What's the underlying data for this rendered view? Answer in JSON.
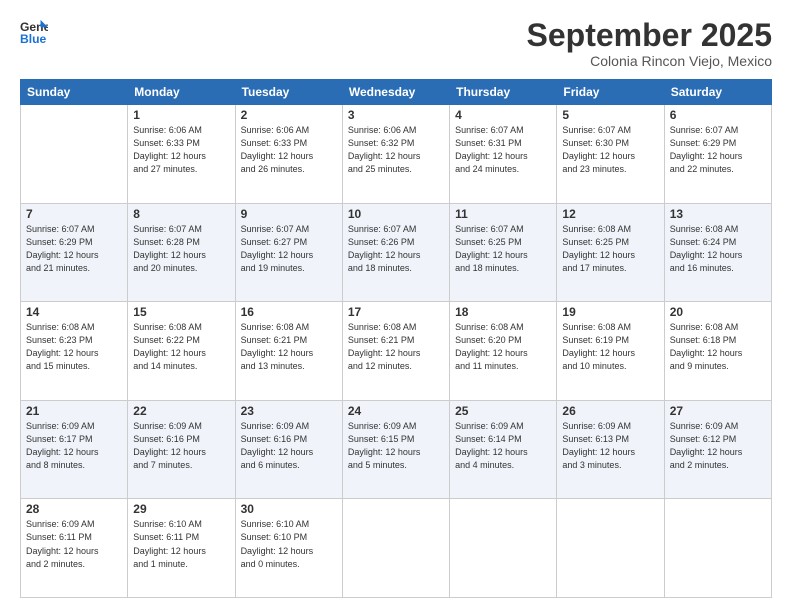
{
  "logo": {
    "line1": "General",
    "line2": "Blue"
  },
  "title": "September 2025",
  "location": "Colonia Rincon Viejo, Mexico",
  "days_of_week": [
    "Sunday",
    "Monday",
    "Tuesday",
    "Wednesday",
    "Thursday",
    "Friday",
    "Saturday"
  ],
  "weeks": [
    [
      {
        "day": "",
        "info": ""
      },
      {
        "day": "1",
        "info": "Sunrise: 6:06 AM\nSunset: 6:33 PM\nDaylight: 12 hours\nand 27 minutes."
      },
      {
        "day": "2",
        "info": "Sunrise: 6:06 AM\nSunset: 6:33 PM\nDaylight: 12 hours\nand 26 minutes."
      },
      {
        "day": "3",
        "info": "Sunrise: 6:06 AM\nSunset: 6:32 PM\nDaylight: 12 hours\nand 25 minutes."
      },
      {
        "day": "4",
        "info": "Sunrise: 6:07 AM\nSunset: 6:31 PM\nDaylight: 12 hours\nand 24 minutes."
      },
      {
        "day": "5",
        "info": "Sunrise: 6:07 AM\nSunset: 6:30 PM\nDaylight: 12 hours\nand 23 minutes."
      },
      {
        "day": "6",
        "info": "Sunrise: 6:07 AM\nSunset: 6:29 PM\nDaylight: 12 hours\nand 22 minutes."
      }
    ],
    [
      {
        "day": "7",
        "info": "Sunrise: 6:07 AM\nSunset: 6:29 PM\nDaylight: 12 hours\nand 21 minutes."
      },
      {
        "day": "8",
        "info": "Sunrise: 6:07 AM\nSunset: 6:28 PM\nDaylight: 12 hours\nand 20 minutes."
      },
      {
        "day": "9",
        "info": "Sunrise: 6:07 AM\nSunset: 6:27 PM\nDaylight: 12 hours\nand 19 minutes."
      },
      {
        "day": "10",
        "info": "Sunrise: 6:07 AM\nSunset: 6:26 PM\nDaylight: 12 hours\nand 18 minutes."
      },
      {
        "day": "11",
        "info": "Sunrise: 6:07 AM\nSunset: 6:25 PM\nDaylight: 12 hours\nand 18 minutes."
      },
      {
        "day": "12",
        "info": "Sunrise: 6:08 AM\nSunset: 6:25 PM\nDaylight: 12 hours\nand 17 minutes."
      },
      {
        "day": "13",
        "info": "Sunrise: 6:08 AM\nSunset: 6:24 PM\nDaylight: 12 hours\nand 16 minutes."
      }
    ],
    [
      {
        "day": "14",
        "info": "Sunrise: 6:08 AM\nSunset: 6:23 PM\nDaylight: 12 hours\nand 15 minutes."
      },
      {
        "day": "15",
        "info": "Sunrise: 6:08 AM\nSunset: 6:22 PM\nDaylight: 12 hours\nand 14 minutes."
      },
      {
        "day": "16",
        "info": "Sunrise: 6:08 AM\nSunset: 6:21 PM\nDaylight: 12 hours\nand 13 minutes."
      },
      {
        "day": "17",
        "info": "Sunrise: 6:08 AM\nSunset: 6:21 PM\nDaylight: 12 hours\nand 12 minutes."
      },
      {
        "day": "18",
        "info": "Sunrise: 6:08 AM\nSunset: 6:20 PM\nDaylight: 12 hours\nand 11 minutes."
      },
      {
        "day": "19",
        "info": "Sunrise: 6:08 AM\nSunset: 6:19 PM\nDaylight: 12 hours\nand 10 minutes."
      },
      {
        "day": "20",
        "info": "Sunrise: 6:08 AM\nSunset: 6:18 PM\nDaylight: 12 hours\nand 9 minutes."
      }
    ],
    [
      {
        "day": "21",
        "info": "Sunrise: 6:09 AM\nSunset: 6:17 PM\nDaylight: 12 hours\nand 8 minutes."
      },
      {
        "day": "22",
        "info": "Sunrise: 6:09 AM\nSunset: 6:16 PM\nDaylight: 12 hours\nand 7 minutes."
      },
      {
        "day": "23",
        "info": "Sunrise: 6:09 AM\nSunset: 6:16 PM\nDaylight: 12 hours\nand 6 minutes."
      },
      {
        "day": "24",
        "info": "Sunrise: 6:09 AM\nSunset: 6:15 PM\nDaylight: 12 hours\nand 5 minutes."
      },
      {
        "day": "25",
        "info": "Sunrise: 6:09 AM\nSunset: 6:14 PM\nDaylight: 12 hours\nand 4 minutes."
      },
      {
        "day": "26",
        "info": "Sunrise: 6:09 AM\nSunset: 6:13 PM\nDaylight: 12 hours\nand 3 minutes."
      },
      {
        "day": "27",
        "info": "Sunrise: 6:09 AM\nSunset: 6:12 PM\nDaylight: 12 hours\nand 2 minutes."
      }
    ],
    [
      {
        "day": "28",
        "info": "Sunrise: 6:09 AM\nSunset: 6:11 PM\nDaylight: 12 hours\nand 2 minutes."
      },
      {
        "day": "29",
        "info": "Sunrise: 6:10 AM\nSunset: 6:11 PM\nDaylight: 12 hours\nand 1 minute."
      },
      {
        "day": "30",
        "info": "Sunrise: 6:10 AM\nSunset: 6:10 PM\nDaylight: 12 hours\nand 0 minutes."
      },
      {
        "day": "",
        "info": ""
      },
      {
        "day": "",
        "info": ""
      },
      {
        "day": "",
        "info": ""
      },
      {
        "day": "",
        "info": ""
      }
    ]
  ]
}
